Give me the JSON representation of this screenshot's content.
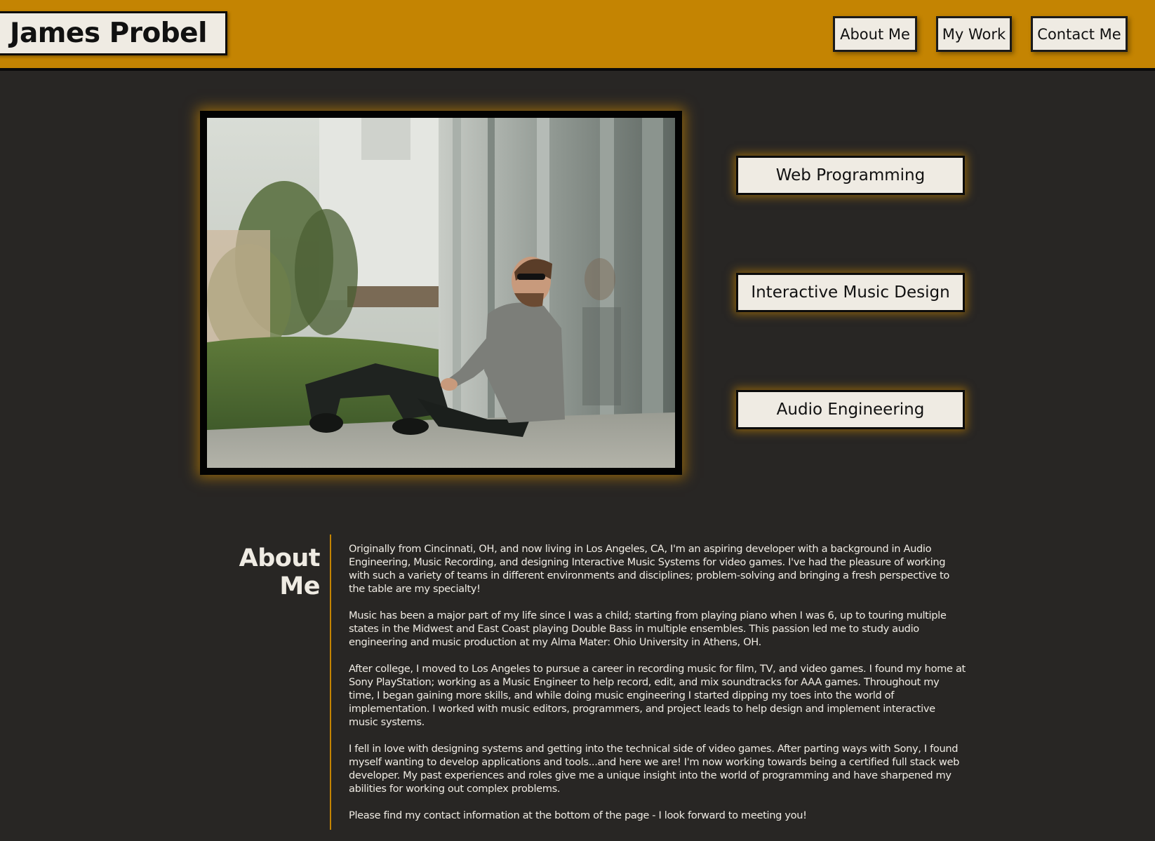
{
  "header": {
    "brand_name": "James Probel",
    "nav": [
      {
        "label": "About Me"
      },
      {
        "label": "My Work"
      },
      {
        "label": "Contact Me"
      }
    ],
    "colors": {
      "bar": "#c48402",
      "button_bg": "#efebe3"
    }
  },
  "hero": {
    "photo_description_icon": "portrait-photo",
    "skills": [
      {
        "label": "Web Programming"
      },
      {
        "label": "Interactive Music Design"
      },
      {
        "label": "Audio Engineering"
      }
    ]
  },
  "about": {
    "heading": "About Me",
    "paragraphs": [
      "Originally from Cincinnati, OH, and now living in Los Angeles, CA, I'm an aspiring developer with a background in Audio Engineering, Music Recording, and designing Interactive Music Systems for video games. I've had the pleasure of working with such a variety of teams in different environments and disciplines; problem-solving and bringing a fresh perspective to the table are my specialty!",
      "Music has been a major part of my life since I was a child; starting from playing piano when I was 6, up to touring multiple states in the Midwest and East Coast playing Double Bass in multiple ensembles. This passion led me to study audio engineering and music production at my Alma Mater: Ohio University in Athens, OH.",
      "After college, I moved to Los Angeles to pursue a career in recording music for film, TV, and video games. I found my home at Sony PlayStation; working as a Music Engineer to help record, edit, and mix soundtracks for AAA games. Throughout my time, I began gaining more skills, and while doing music engineering I started dipping my toes into the world of implementation. I worked with music editors, programmers, and project leads to help design and implement interactive music systems.",
      "I fell in love with designing systems and getting into the technical side of video games. After parting ways with Sony, I found myself wanting to develop applications and tools...and here we are! I'm now working towards being a certified full stack web developer. My past experiences and roles give me a unique insight into the world of programming and have sharpened my abilities for working out complex problems.",
      "Please find my contact information at the bottom of the page - I look forward to meeting you!"
    ]
  },
  "theme": {
    "background": "#282624",
    "accent": "#c48402",
    "text_light": "#efebe3"
  }
}
